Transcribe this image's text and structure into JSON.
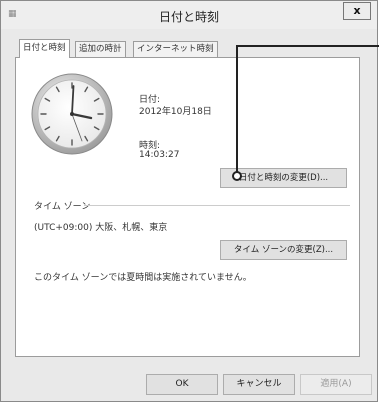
{
  "window": {
    "title": "日付と時刻",
    "close_label": "x"
  },
  "tabs": [
    {
      "label": "日付と時刻"
    },
    {
      "label": "追加の時計"
    },
    {
      "label": "インターネット時刻"
    }
  ],
  "date_time": {
    "date_label": "日付:",
    "date_value": "2012年10月18日",
    "time_label": "時刻:",
    "time_value": "14:03:27",
    "change_button": "日付と時刻の変更(D)..."
  },
  "timezone": {
    "section_label": "タイム ゾーン",
    "value": "(UTC+09:00) 大阪、札幌、東京",
    "change_button": "タイム ゾーンの変更(Z)...",
    "dst_note": "このタイム ゾーンでは夏時間は実施されていません。"
  },
  "footer": {
    "ok": "OK",
    "cancel": "キャンセル",
    "apply": "適用(A)"
  }
}
